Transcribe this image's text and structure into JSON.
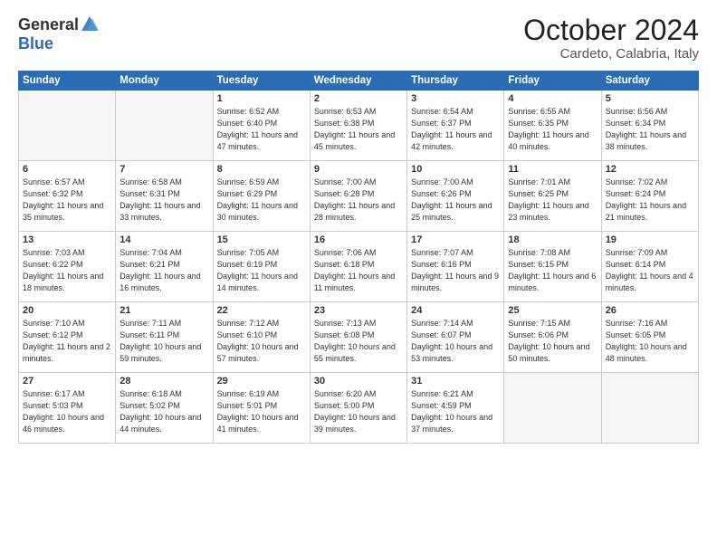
{
  "header": {
    "logo_general": "General",
    "logo_blue": "Blue",
    "month_title": "October 2024",
    "location": "Cardeto, Calabria, Italy"
  },
  "days_of_week": [
    "Sunday",
    "Monday",
    "Tuesday",
    "Wednesday",
    "Thursday",
    "Friday",
    "Saturday"
  ],
  "weeks": [
    [
      {
        "day": "",
        "empty": true
      },
      {
        "day": "",
        "empty": true
      },
      {
        "day": "1",
        "sunrise": "Sunrise: 6:52 AM",
        "sunset": "Sunset: 6:40 PM",
        "daylight": "Daylight: 11 hours and 47 minutes."
      },
      {
        "day": "2",
        "sunrise": "Sunrise: 6:53 AM",
        "sunset": "Sunset: 6:38 PM",
        "daylight": "Daylight: 11 hours and 45 minutes."
      },
      {
        "day": "3",
        "sunrise": "Sunrise: 6:54 AM",
        "sunset": "Sunset: 6:37 PM",
        "daylight": "Daylight: 11 hours and 42 minutes."
      },
      {
        "day": "4",
        "sunrise": "Sunrise: 6:55 AM",
        "sunset": "Sunset: 6:35 PM",
        "daylight": "Daylight: 11 hours and 40 minutes."
      },
      {
        "day": "5",
        "sunrise": "Sunrise: 6:56 AM",
        "sunset": "Sunset: 6:34 PM",
        "daylight": "Daylight: 11 hours and 38 minutes."
      }
    ],
    [
      {
        "day": "6",
        "sunrise": "Sunrise: 6:57 AM",
        "sunset": "Sunset: 6:32 PM",
        "daylight": "Daylight: 11 hours and 35 minutes."
      },
      {
        "day": "7",
        "sunrise": "Sunrise: 6:58 AM",
        "sunset": "Sunset: 6:31 PM",
        "daylight": "Daylight: 11 hours and 33 minutes."
      },
      {
        "day": "8",
        "sunrise": "Sunrise: 6:59 AM",
        "sunset": "Sunset: 6:29 PM",
        "daylight": "Daylight: 11 hours and 30 minutes."
      },
      {
        "day": "9",
        "sunrise": "Sunrise: 7:00 AM",
        "sunset": "Sunset: 6:28 PM",
        "daylight": "Daylight: 11 hours and 28 minutes."
      },
      {
        "day": "10",
        "sunrise": "Sunrise: 7:00 AM",
        "sunset": "Sunset: 6:26 PM",
        "daylight": "Daylight: 11 hours and 25 minutes."
      },
      {
        "day": "11",
        "sunrise": "Sunrise: 7:01 AM",
        "sunset": "Sunset: 6:25 PM",
        "daylight": "Daylight: 11 hours and 23 minutes."
      },
      {
        "day": "12",
        "sunrise": "Sunrise: 7:02 AM",
        "sunset": "Sunset: 6:24 PM",
        "daylight": "Daylight: 11 hours and 21 minutes."
      }
    ],
    [
      {
        "day": "13",
        "sunrise": "Sunrise: 7:03 AM",
        "sunset": "Sunset: 6:22 PM",
        "daylight": "Daylight: 11 hours and 18 minutes."
      },
      {
        "day": "14",
        "sunrise": "Sunrise: 7:04 AM",
        "sunset": "Sunset: 6:21 PM",
        "daylight": "Daylight: 11 hours and 16 minutes."
      },
      {
        "day": "15",
        "sunrise": "Sunrise: 7:05 AM",
        "sunset": "Sunset: 6:19 PM",
        "daylight": "Daylight: 11 hours and 14 minutes."
      },
      {
        "day": "16",
        "sunrise": "Sunrise: 7:06 AM",
        "sunset": "Sunset: 6:18 PM",
        "daylight": "Daylight: 11 hours and 11 minutes."
      },
      {
        "day": "17",
        "sunrise": "Sunrise: 7:07 AM",
        "sunset": "Sunset: 6:16 PM",
        "daylight": "Daylight: 11 hours and 9 minutes."
      },
      {
        "day": "18",
        "sunrise": "Sunrise: 7:08 AM",
        "sunset": "Sunset: 6:15 PM",
        "daylight": "Daylight: 11 hours and 6 minutes."
      },
      {
        "day": "19",
        "sunrise": "Sunrise: 7:09 AM",
        "sunset": "Sunset: 6:14 PM",
        "daylight": "Daylight: 11 hours and 4 minutes."
      }
    ],
    [
      {
        "day": "20",
        "sunrise": "Sunrise: 7:10 AM",
        "sunset": "Sunset: 6:12 PM",
        "daylight": "Daylight: 11 hours and 2 minutes."
      },
      {
        "day": "21",
        "sunrise": "Sunrise: 7:11 AM",
        "sunset": "Sunset: 6:11 PM",
        "daylight": "Daylight: 10 hours and 59 minutes."
      },
      {
        "day": "22",
        "sunrise": "Sunrise: 7:12 AM",
        "sunset": "Sunset: 6:10 PM",
        "daylight": "Daylight: 10 hours and 57 minutes."
      },
      {
        "day": "23",
        "sunrise": "Sunrise: 7:13 AM",
        "sunset": "Sunset: 6:08 PM",
        "daylight": "Daylight: 10 hours and 55 minutes."
      },
      {
        "day": "24",
        "sunrise": "Sunrise: 7:14 AM",
        "sunset": "Sunset: 6:07 PM",
        "daylight": "Daylight: 10 hours and 53 minutes."
      },
      {
        "day": "25",
        "sunrise": "Sunrise: 7:15 AM",
        "sunset": "Sunset: 6:06 PM",
        "daylight": "Daylight: 10 hours and 50 minutes."
      },
      {
        "day": "26",
        "sunrise": "Sunrise: 7:16 AM",
        "sunset": "Sunset: 6:05 PM",
        "daylight": "Daylight: 10 hours and 48 minutes."
      }
    ],
    [
      {
        "day": "27",
        "sunrise": "Sunrise: 6:17 AM",
        "sunset": "Sunset: 5:03 PM",
        "daylight": "Daylight: 10 hours and 46 minutes."
      },
      {
        "day": "28",
        "sunrise": "Sunrise: 6:18 AM",
        "sunset": "Sunset: 5:02 PM",
        "daylight": "Daylight: 10 hours and 44 minutes."
      },
      {
        "day": "29",
        "sunrise": "Sunrise: 6:19 AM",
        "sunset": "Sunset: 5:01 PM",
        "daylight": "Daylight: 10 hours and 41 minutes."
      },
      {
        "day": "30",
        "sunrise": "Sunrise: 6:20 AM",
        "sunset": "Sunset: 5:00 PM",
        "daylight": "Daylight: 10 hours and 39 minutes."
      },
      {
        "day": "31",
        "sunrise": "Sunrise: 6:21 AM",
        "sunset": "Sunset: 4:59 PM",
        "daylight": "Daylight: 10 hours and 37 minutes."
      },
      {
        "day": "",
        "empty": true
      },
      {
        "day": "",
        "empty": true
      }
    ]
  ]
}
